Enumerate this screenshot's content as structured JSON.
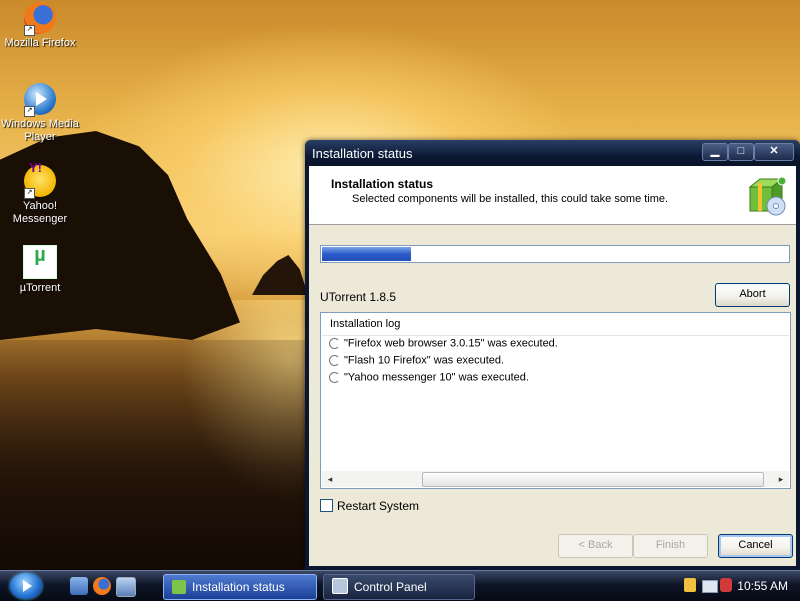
{
  "desktop": {
    "icons": [
      {
        "label": "Mozilla Firefox",
        "icon": "firefox-icon"
      },
      {
        "label": "Windows Media Player",
        "icon": "media-player-icon"
      },
      {
        "label": "Yahoo! Messenger",
        "icon": "yahoo-messenger-icon"
      },
      {
        "label": "µTorrent",
        "icon": "utorrent-icon"
      }
    ]
  },
  "dialog": {
    "window_title": "Installation status",
    "header_title": "Installation status",
    "header_subtitle": "Selected components will be installed, this could take some time.",
    "progress": 0.19,
    "component_name": "UTorrent 1.8.5",
    "abort_label": "Abort",
    "log_title": "Installation log",
    "log_entries": [
      "\"Firefox web browser 3.0.15\" was executed.",
      "\"Flash 10 Firefox\" was executed.",
      "\"Yahoo messenger 10\" was executed."
    ],
    "restart_label": "Restart System",
    "restart_checked": false,
    "back_label": "< Back",
    "finish_label": "Finish",
    "cancel_label": "Cancel",
    "accent_color": "#2c5ccc"
  },
  "taskbar": {
    "tasks": [
      {
        "label": "Installation status",
        "active": true
      },
      {
        "label": "Control Panel",
        "active": false
      }
    ],
    "clock": "10:55 AM"
  }
}
